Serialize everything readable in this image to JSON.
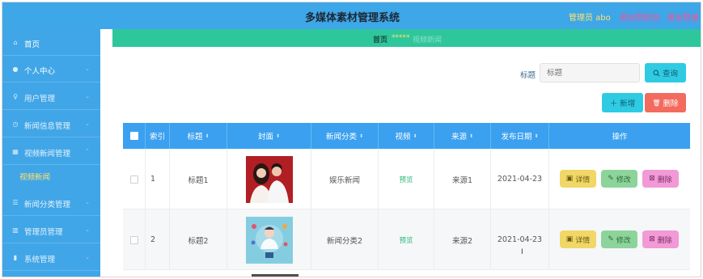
{
  "header": {
    "title": "多媒体素材管理系统",
    "admin_label": "管理员 abo",
    "link_frontend": "退出到前台",
    "link_logout": "退出登录"
  },
  "sidebar": {
    "items": [
      {
        "label": "首页",
        "icon": "home-icon"
      },
      {
        "label": "个人中心",
        "icon": "person-icon"
      },
      {
        "label": "用户管理",
        "icon": "user-icon"
      },
      {
        "label": "新闻信息管理",
        "icon": "clock-icon"
      },
      {
        "label": "视频新闻管理",
        "icon": "film-icon"
      },
      {
        "label": "新闻分类管理",
        "icon": "list-icon"
      },
      {
        "label": "管理员管理",
        "icon": "grid-icon"
      },
      {
        "label": "系统管理",
        "icon": "bar-chart-icon"
      }
    ],
    "active_sub": "视频新闻"
  },
  "breadcrumb": {
    "home": "首页",
    "separator": "*****",
    "current": "视频新闻"
  },
  "search": {
    "label": "标题",
    "placeholder": "标题",
    "button": "查询"
  },
  "toolbar": {
    "add": "新增",
    "delete": "删除"
  },
  "table": {
    "headers": [
      "索引",
      "标题",
      "封面",
      "新闻分类",
      "视频",
      "来源",
      "发布日期",
      "操作"
    ],
    "rows": [
      {
        "index": "1",
        "title": "标题1",
        "category": "娱乐新闻",
        "video": "预览",
        "source": "来源1",
        "date": "2021-04-23"
      },
      {
        "index": "2",
        "title": "标题2",
        "category": "新闻分类2",
        "video": "预览",
        "source": "来源2",
        "date": "2021-04-23"
      }
    ],
    "actions": {
      "detail": "详情",
      "edit": "修改",
      "delete": "删除"
    }
  },
  "colors": {
    "topbar": "#3ea7e8",
    "sidebar": "#41a6e7",
    "breadcrumb": "#2ec79c",
    "table_header": "#3aa0ef",
    "btn_cyan": "#2ecbe3",
    "btn_red": "#f26b5e",
    "btn_detail": "#f0d766",
    "btn_edit": "#8dd49b",
    "btn_del": "#f19ad6"
  }
}
